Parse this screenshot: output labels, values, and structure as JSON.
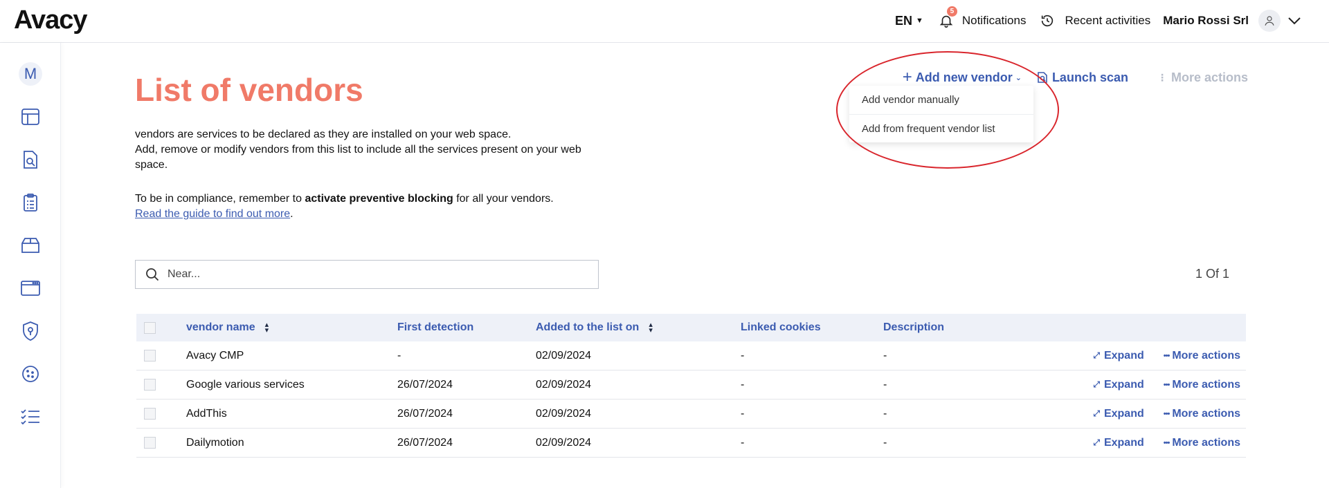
{
  "app": {
    "logo": "Avacy",
    "language": "EN",
    "notifications_label": "Notifications",
    "notifications_count": "5",
    "recent_label": "Recent activities",
    "company": "Mario Rossi Srl"
  },
  "sidebar": {
    "avatar_letter": "M",
    "icons": [
      "layout-icon",
      "document-search-icon",
      "clipboard-list-icon",
      "box-icon",
      "browser-window-icon",
      "shield-icon",
      "cookie-icon",
      "checklist-icon"
    ]
  },
  "page": {
    "title": "List of vendors",
    "intro_line1": "vendors are services to be declared as they are installed on your web space.",
    "intro_line2": "Add, remove or modify vendors from this list to include all the services present on your web space.",
    "compliance_pre": "To be in compliance, remember to ",
    "compliance_bold": "activate preventive blocking",
    "compliance_post": " for all your vendors.",
    "guide_link": "Read the guide to find out more",
    "guide_dot": "."
  },
  "actions": {
    "add_vendor": "Add new vendor",
    "launch_scan": "Launch scan",
    "more_actions": "More actions"
  },
  "dropdown": {
    "items": [
      "Add vendor manually",
      "Add from frequent vendor list"
    ]
  },
  "search": {
    "placeholder": "Near..."
  },
  "pager": "1 Of 1",
  "table": {
    "headers": {
      "name": "vendor name",
      "first": "First detection",
      "added": "Added to the list on",
      "linked": "Linked cookies",
      "desc": "Description"
    },
    "rows": [
      {
        "name": "Avacy CMP",
        "first": "-",
        "added": "02/09/2024",
        "linked": "-",
        "desc": "-"
      },
      {
        "name": "Google various services",
        "first": "26/07/2024",
        "added": "02/09/2024",
        "linked": "-",
        "desc": "-"
      },
      {
        "name": "AddThis",
        "first": "26/07/2024",
        "added": "02/09/2024",
        "linked": "-",
        "desc": "-"
      },
      {
        "name": "Dailymotion",
        "first": "26/07/2024",
        "added": "02/09/2024",
        "linked": "-",
        "desc": "-"
      }
    ],
    "expand_label": "Expand",
    "more_label": "More actions"
  },
  "colors": {
    "accent": "#f07a68",
    "link": "#3b5bb0",
    "highlight_ellipse": "#d9252c",
    "header_bg": "#eef1f8"
  }
}
